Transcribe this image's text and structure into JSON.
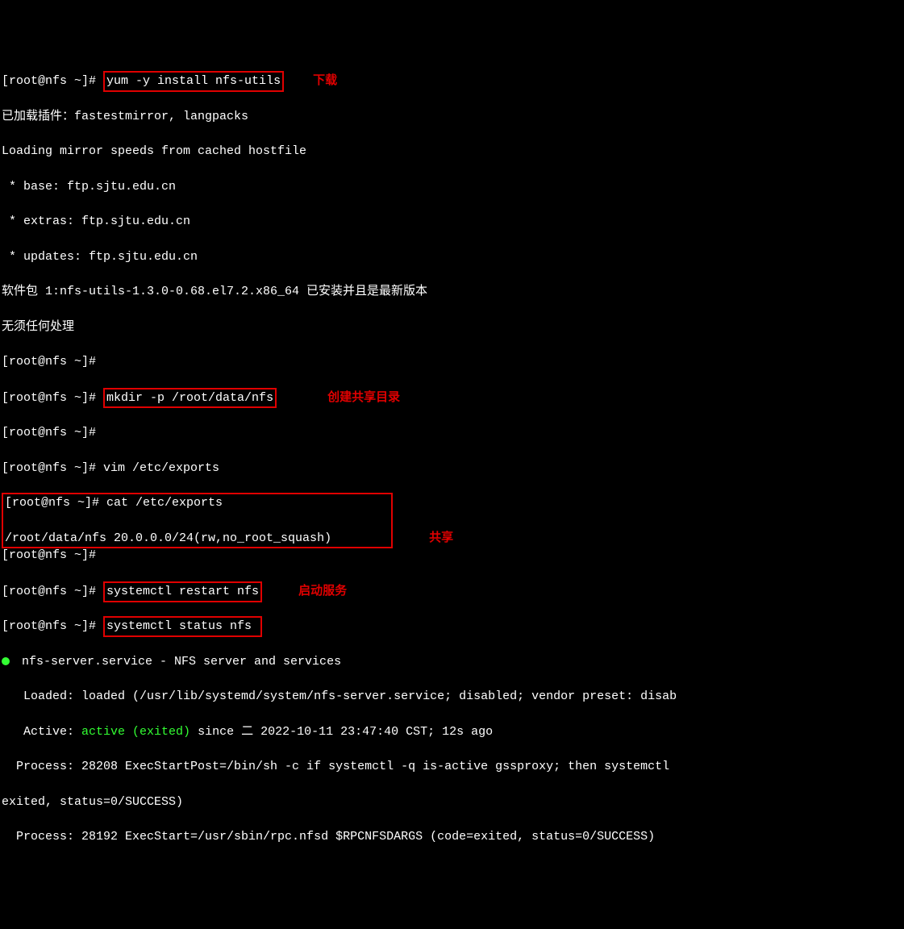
{
  "prompt": "[root@nfs ~]# ",
  "cmd": {
    "yum": "yum -y install nfs-utils",
    "mkdir": "mkdir -p /root/data/nfs",
    "vim": "vim /etc/exports",
    "cat": "cat /etc/exports",
    "restart": "systemctl restart nfs",
    "status": "systemctl status nfs"
  },
  "annot": {
    "download": "下载",
    "create_share_dir": "创建共享目录",
    "share": "共享",
    "start_service": "启动服务"
  },
  "out": {
    "plugins_loaded": "已加载插件：fastestmirror, langpacks",
    "loading_mirror": "Loading mirror speeds from cached hostfile",
    "base": " * base: ftp.sjtu.edu.cn",
    "extras": " * extras: ftp.sjtu.edu.cn",
    "updates": " * updates: ftp.sjtu.edu.cn",
    "pkg_latest": "软件包 1:nfs-utils-1.3.0-0.68.el7.2.x86_64 已安装并且是最新版本",
    "nothing_todo": "无须任何处理",
    "exports_content": "/root/data/nfs 20.0.0.0/24(rw,no_root_squash)",
    "svc_header": " nfs-server.service - NFS server and services",
    "svc_loaded": "   Loaded: loaded (/usr/lib/systemd/system/nfs-server.service; disabled; vendor preset: disab",
    "svc_active_prefix": "   Active: ",
    "svc_active_status": "active (exited)",
    "svc_active_since": " since 二 2022-10-11 23:47:40 CST; 12s ago",
    "svc_proc1": "  Process: 28208 ExecStartPost=/bin/sh -c if systemctl -q is-active gssproxy; then systemctl ",
    "svc_proc1b": "exited, status=0/SUCCESS)",
    "svc_proc2": "  Process: 28192 ExecStart=/usr/sbin/rpc.nfsd $RPCNFSDARGS (code=exited, status=0/SUCCESS)"
  }
}
